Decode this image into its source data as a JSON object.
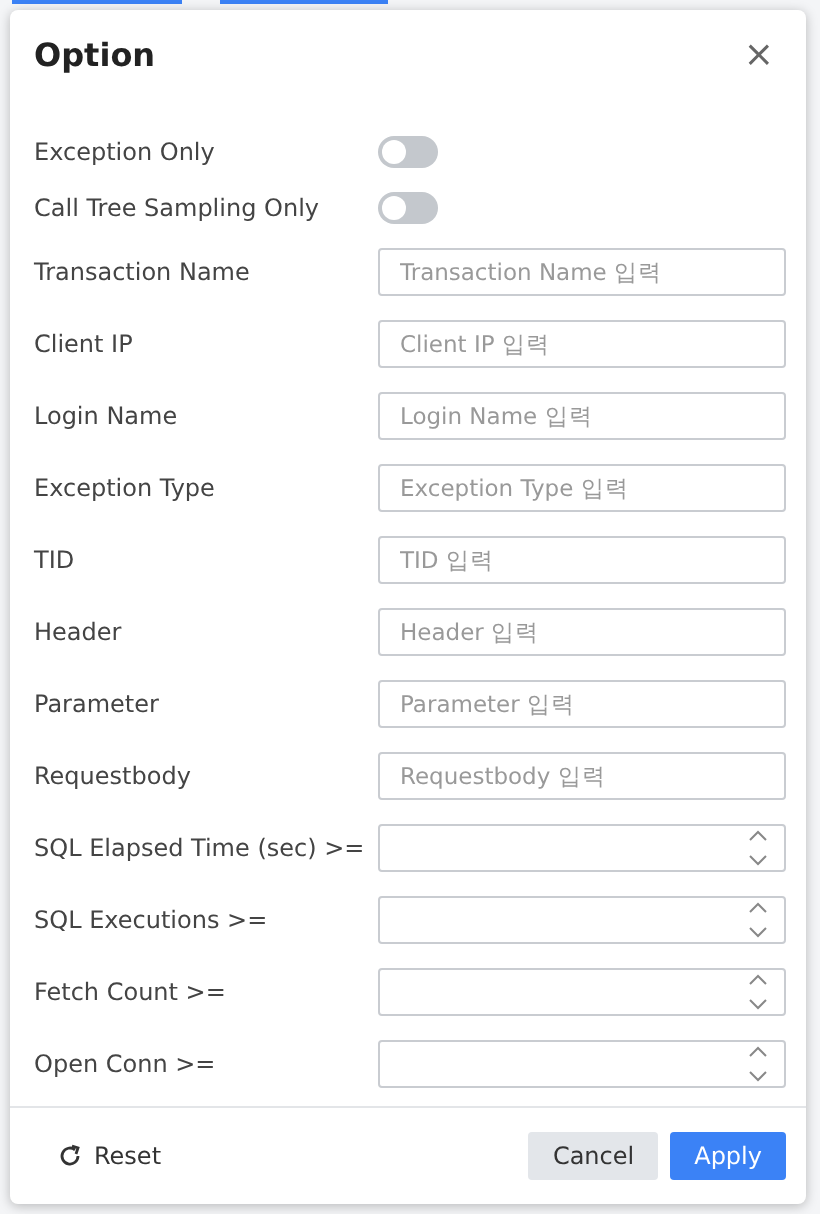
{
  "dialog": {
    "title": "Option",
    "close": "×"
  },
  "fields": [
    {
      "kind": "toggle",
      "label": "Exception Only",
      "on": false
    },
    {
      "kind": "toggle",
      "label": "Call Tree Sampling Only",
      "on": false
    },
    {
      "kind": "text",
      "label": "Transaction Name",
      "placeholder": "Transaction Name 입력"
    },
    {
      "kind": "text",
      "label": "Client IP",
      "placeholder": "Client IP 입력"
    },
    {
      "kind": "text",
      "label": "Login Name",
      "placeholder": "Login Name 입력"
    },
    {
      "kind": "text",
      "label": "Exception Type",
      "placeholder": "Exception Type 입력"
    },
    {
      "kind": "text",
      "label": "TID",
      "placeholder": "TID 입력"
    },
    {
      "kind": "text",
      "label": "Header",
      "placeholder": "Header 입력"
    },
    {
      "kind": "text",
      "label": "Parameter",
      "placeholder": "Parameter 입력"
    },
    {
      "kind": "text",
      "label": "Requestbody",
      "placeholder": "Requestbody 입력"
    },
    {
      "kind": "number",
      "label": "SQL Elapsed Time (sec) >="
    },
    {
      "kind": "number",
      "label": "SQL Executions >="
    },
    {
      "kind": "number",
      "label": "Fetch Count >="
    },
    {
      "kind": "number",
      "label": "Open Conn >="
    }
  ],
  "footer": {
    "reset": "Reset",
    "cancel": "Cancel",
    "apply": "Apply"
  }
}
